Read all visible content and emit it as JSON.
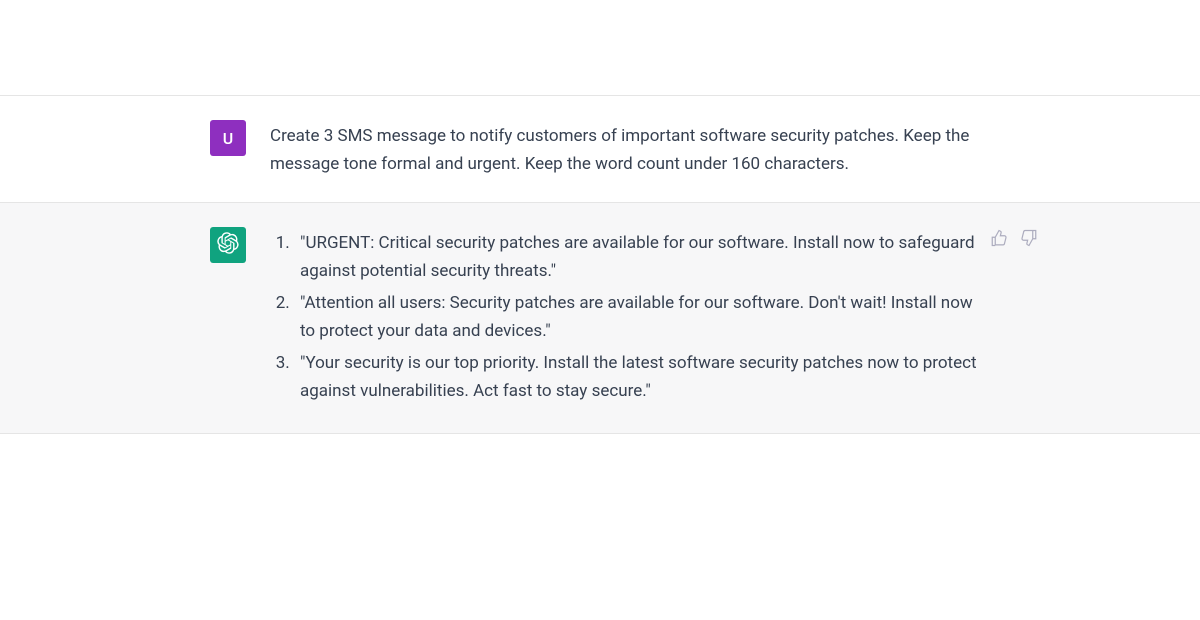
{
  "user": {
    "avatar_letter": "U",
    "prompt": "Create 3 SMS message to notify customers of important software security patches. Keep the message tone formal and urgent. Keep the word count under 160 characters."
  },
  "assistant": {
    "items": [
      "\"URGENT: Critical security patches are available for our software. Install now to safeguard against potential security threats.\"",
      "\"Attention all users: Security patches are available for our software. Don't wait! Install now to protect your data and devices.\"",
      "\"Your security is our top priority. Install the latest software security patches now to protect against vulnerabilities. Act fast to stay secure.\""
    ]
  },
  "feedback": {
    "up_name": "thumbs-up-icon",
    "down_name": "thumbs-down-icon"
  }
}
